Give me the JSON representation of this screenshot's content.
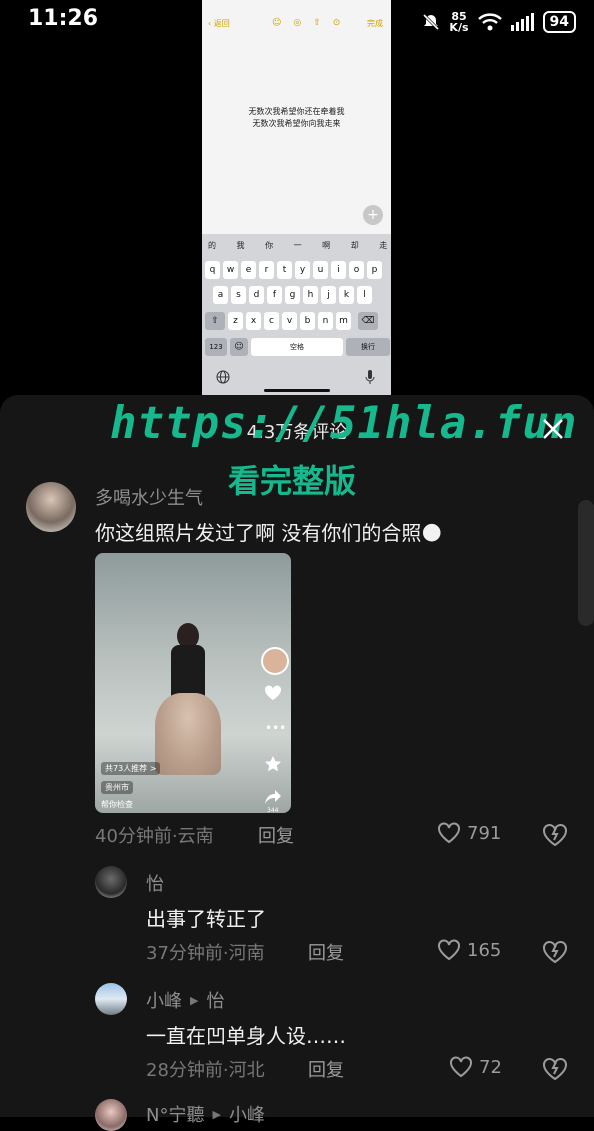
{
  "status_bar": {
    "time": "11:26",
    "net_speed_value": "85",
    "net_speed_unit": "K/s",
    "battery": "94"
  },
  "embedded_screen": {
    "back_label": "返回",
    "done_label": "完成",
    "note_lines": [
      "无数次我希望你还在牵着我",
      "无数次我希望你向我走来"
    ],
    "candidates": "的 我 你 一 啊 却 走 这 是",
    "row1": [
      "q",
      "w",
      "e",
      "r",
      "t",
      "y",
      "u",
      "i",
      "o",
      "p"
    ],
    "row2": [
      "a",
      "s",
      "d",
      "f",
      "g",
      "h",
      "j",
      "k",
      "l"
    ],
    "row3": [
      "z",
      "x",
      "c",
      "v",
      "b",
      "n",
      "m"
    ],
    "key_123": "123",
    "space_label": "空格",
    "enter_label": "换行"
  },
  "sheet": {
    "title": "4.3万条评论",
    "watermark_url": "https://51hla.fun",
    "watermark_sub": "看完整版"
  },
  "comments": [
    {
      "name": "多喝水少生气",
      "text": "你这组照片发过了啊  没有你们的合照🌑",
      "time_loc": "40分钟前·云南",
      "reply": "回复",
      "likes": "791"
    },
    {
      "name": "怡",
      "text": "出事了转正了",
      "time_loc": "37分钟前·河南",
      "reply": "回复",
      "likes": "165"
    },
    {
      "name": "小峰",
      "reply_to": "怡",
      "text": "一直在凹单身人设……",
      "time_loc": "28分钟前·河北",
      "reply": "回复",
      "likes": "72"
    },
    {
      "name": "N°宁聽",
      "reply_to": "小峰"
    }
  ],
  "photo": {
    "likes_tag": "共73人推荐 >",
    "location_tag": "贵州市",
    "bottom_tag": "帮你检查",
    "count": "344"
  }
}
